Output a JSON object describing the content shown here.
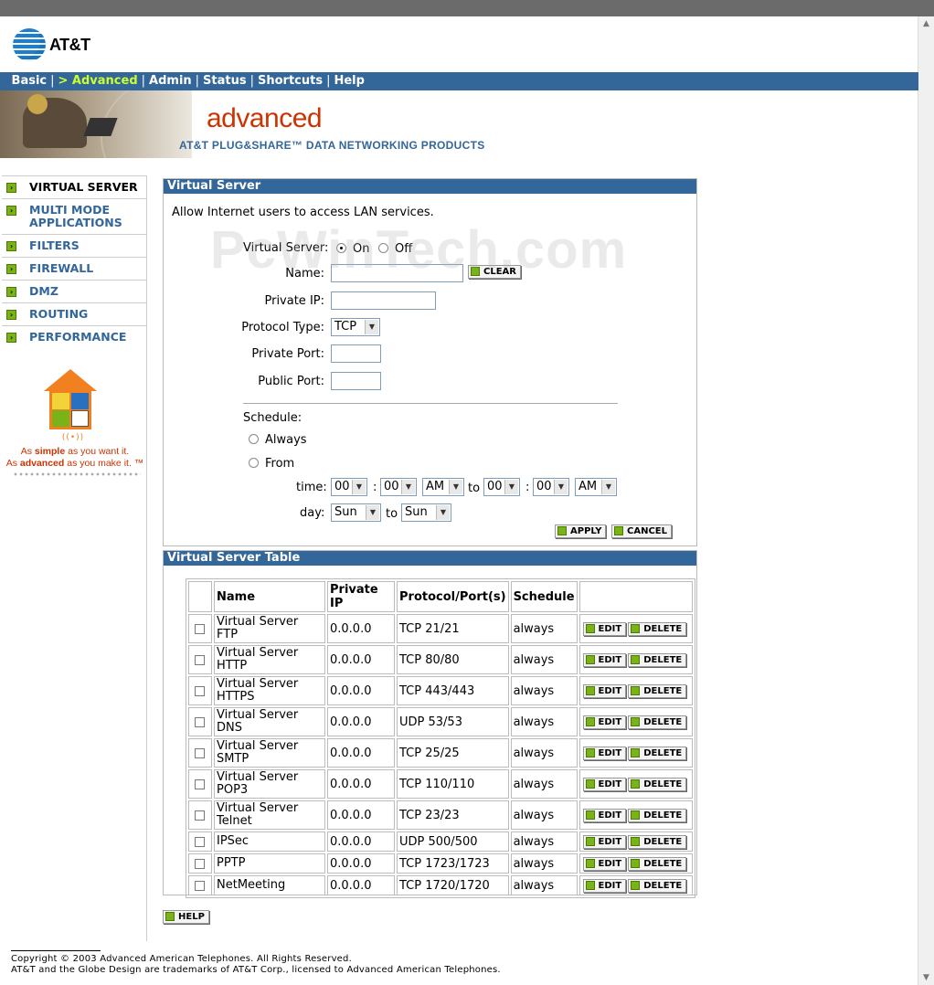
{
  "brand": {
    "name": "AT&T"
  },
  "nav": {
    "items": [
      {
        "label": "Basic"
      },
      {
        "label": "> Advanced"
      },
      {
        "label": "Admin"
      },
      {
        "label": "Status"
      },
      {
        "label": "Shortcuts"
      },
      {
        "label": "Help"
      }
    ],
    "separator": "|"
  },
  "banner": {
    "title": "advanced",
    "subtitle": "AT&T PLUG&SHARE™ DATA NETWORKING PRODUCTS"
  },
  "sidebar": {
    "items": [
      {
        "label": "VIRTUAL SERVER"
      },
      {
        "label": "MULTI MODE APPLICATIONS"
      },
      {
        "label": "FILTERS"
      },
      {
        "label": "FIREWALL"
      },
      {
        "label": "DMZ"
      },
      {
        "label": "ROUTING"
      },
      {
        "label": "PERFORMANCE"
      }
    ],
    "tagline_pre1": "As ",
    "tagline_em1": "simple",
    "tagline_post1": " as you want it.",
    "tagline_pre2": "As ",
    "tagline_em2": "advanced",
    "tagline_post2": " as you make it. ™"
  },
  "form": {
    "title": "Virtual Server",
    "intro": "Allow Internet users to access LAN services.",
    "vs_label": "Virtual Server:",
    "on_label": "On",
    "off_label": "Off",
    "name_label": "Name:",
    "name_value": "",
    "clear_label": "CLEAR",
    "private_ip_label": "Private IP:",
    "private_ip_value": "",
    "protocol_label": "Protocol Type:",
    "protocol_value": "TCP",
    "private_port_label": "Private Port:",
    "private_port_value": "",
    "public_port_label": "Public Port:",
    "public_port_value": "",
    "schedule_label": "Schedule:",
    "always_label": "Always",
    "from_label": "From",
    "time_label": "time:",
    "time_from_h": "00",
    "time_from_m": "00",
    "time_from_ampm": "AM",
    "to_label": "to",
    "colon": ":",
    "time_to_h": "00",
    "time_to_m": "00",
    "time_to_ampm": "AM",
    "day_label": "day:",
    "day_from": "Sun",
    "day_to": "Sun",
    "apply_label": "APPLY",
    "cancel_label": "CANCEL"
  },
  "table": {
    "title": "Virtual Server Table",
    "headers": [
      "",
      "Name",
      "Private IP",
      "Protocol/Port(s)",
      "Schedule",
      ""
    ],
    "edit_label": "EDIT",
    "delete_label": "DELETE",
    "rows": [
      {
        "name": "Virtual Server FTP",
        "ip": "0.0.0.0",
        "proto": "TCP 21/21",
        "schedule": "always"
      },
      {
        "name": "Virtual Server HTTP",
        "ip": "0.0.0.0",
        "proto": "TCP 80/80",
        "schedule": "always"
      },
      {
        "name": "Virtual Server HTTPS",
        "ip": "0.0.0.0",
        "proto": "TCP 443/443",
        "schedule": "always"
      },
      {
        "name": "Virtual Server DNS",
        "ip": "0.0.0.0",
        "proto": "UDP 53/53",
        "schedule": "always"
      },
      {
        "name": "Virtual Server SMTP",
        "ip": "0.0.0.0",
        "proto": "TCP 25/25",
        "schedule": "always"
      },
      {
        "name": "Virtual Server POP3",
        "ip": "0.0.0.0",
        "proto": "TCP 110/110",
        "schedule": "always"
      },
      {
        "name": "Virtual Server Telnet",
        "ip": "0.0.0.0",
        "proto": "TCP 23/23",
        "schedule": "always"
      },
      {
        "name": "IPSec",
        "ip": "0.0.0.0",
        "proto": "UDP 500/500",
        "schedule": "always"
      },
      {
        "name": "PPTP",
        "ip": "0.0.0.0",
        "proto": "TCP 1723/1723",
        "schedule": "always"
      },
      {
        "name": "NetMeeting",
        "ip": "0.0.0.0",
        "proto": "TCP 1720/1720",
        "schedule": "always"
      }
    ]
  },
  "help_label": "HELP",
  "footer": {
    "line1": "Copyright © 2003 Advanced American Telephones. All Rights Reserved.",
    "line2": "AT&T and the Globe Design are trademarks of AT&T Corp., licensed to Advanced American Telephones."
  },
  "watermark": "PcWinTech.com",
  "colors": {
    "nav_bg": "#336699",
    "active_nav": "#ccff33",
    "banner_title": "#cc3300",
    "arrow_green": "#7ab317"
  }
}
